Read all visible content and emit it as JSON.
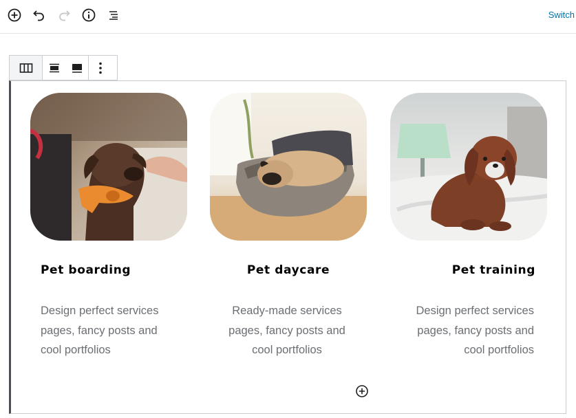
{
  "toolbar": {
    "icons": [
      "add-block-icon",
      "undo-icon",
      "redo-icon",
      "info-icon",
      "outline-icon"
    ],
    "switch_label": "Switch"
  },
  "block_toolbar": {
    "icons": [
      "columns-icon",
      "align-center-icon",
      "align-wide-icon",
      "more-options-icon"
    ]
  },
  "columns": [
    {
      "title": "Pet boarding",
      "desc": [
        "Design perfect services",
        "pages, fancy posts and",
        "cool portfolios"
      ],
      "align": "left",
      "image": "dog-with-orange-bow-photo"
    },
    {
      "title": "Pet daycare",
      "desc": [
        "Ready-made services",
        "pages, fancy posts and",
        "cool portfolios"
      ],
      "align": "center",
      "image": "pug-in-basket-photo"
    },
    {
      "title": "Pet training",
      "desc": [
        "Design perfect services",
        "pages, fancy posts and",
        "cool portfolios"
      ],
      "align": "right",
      "image": "puppy-on-bed-photo"
    }
  ],
  "colors": {
    "accent": "#0073aa",
    "text": "#000000",
    "muted": "#6b6f73"
  }
}
